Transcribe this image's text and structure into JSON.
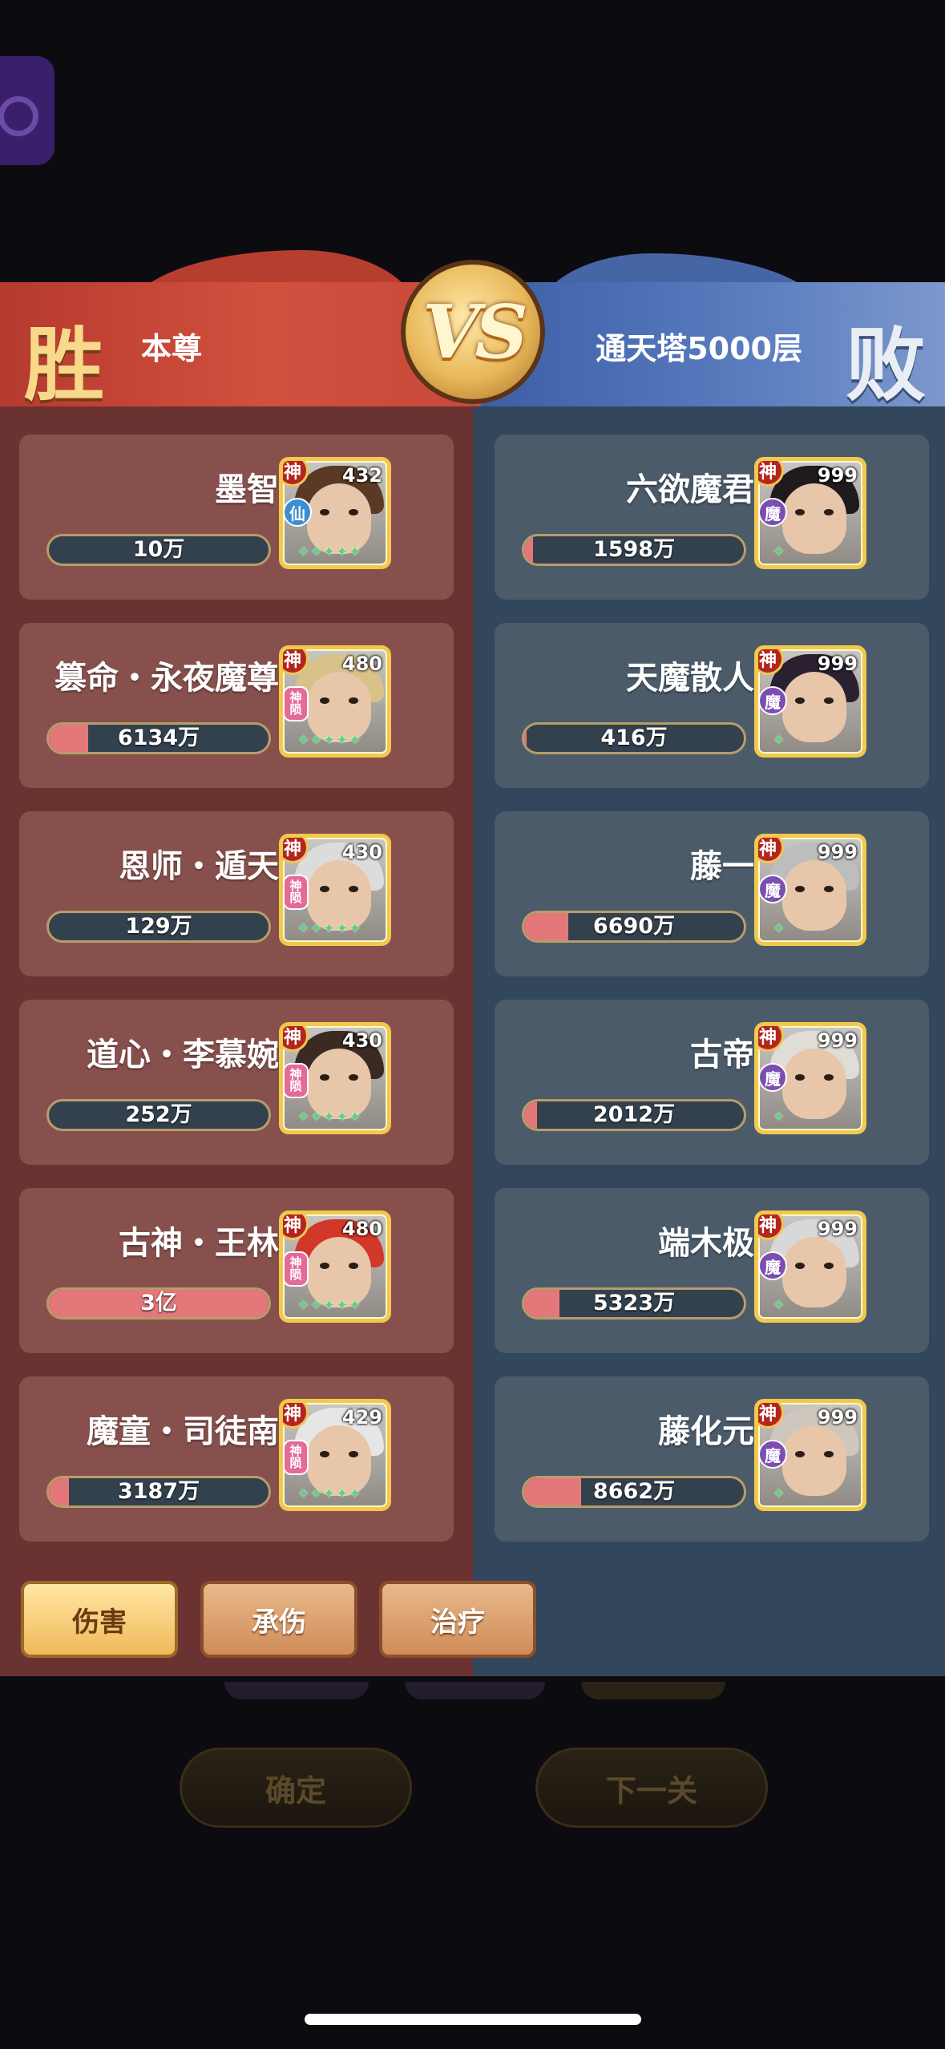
{
  "header": {
    "win_label": "胜",
    "lose_label": "败",
    "vs_label": "VS",
    "left_player": "本尊",
    "right_player": "通天塔5000层"
  },
  "left_team": [
    {
      "name": "墨智",
      "level": "432",
      "rank": "神",
      "faction": "仙",
      "faction_type": "xian",
      "value": "10万",
      "fill": 0.0,
      "hair": "#5a3a24"
    },
    {
      "name": "篡命・永夜魔尊",
      "level": "480",
      "rank": "神",
      "faction": "神陨",
      "faction_type": "sj",
      "value": "6134万",
      "fill": 0.18,
      "hair": "#d8c28a"
    },
    {
      "name": "恩师・遁天",
      "level": "430",
      "rank": "神",
      "faction": "神陨",
      "faction_type": "sj",
      "value": "129万",
      "fill": 0.0,
      "hair": "#dcdcdc"
    },
    {
      "name": "道心・李慕婉",
      "level": "430",
      "rank": "神",
      "faction": "神陨",
      "faction_type": "sj",
      "value": "252万",
      "fill": 0.0,
      "hair": "#3a2a22"
    },
    {
      "name": "古神・王林",
      "level": "480",
      "rank": "神",
      "faction": "神陨",
      "faction_type": "sj",
      "value": "3亿",
      "fill": 1.0,
      "hair": "#d2372a"
    },
    {
      "name": "魔童・司徒南",
      "level": "429",
      "rank": "神",
      "faction": "神陨",
      "faction_type": "sj",
      "value": "3187万",
      "fill": 0.09,
      "hair": "#e6e6e6"
    }
  ],
  "right_team": [
    {
      "name": "六欲魔君",
      "level": "999",
      "rank": "神",
      "faction": "魔",
      "faction_type": "mo",
      "value": "1598万",
      "fill": 0.04,
      "hair": "#1e1a1e"
    },
    {
      "name": "天魔散人",
      "level": "999",
      "rank": "神",
      "faction": "魔",
      "faction_type": "mo",
      "value": "416万",
      "fill": 0.01,
      "hair": "#2a2030"
    },
    {
      "name": "藤一",
      "level": "999",
      "rank": "神",
      "faction": "魔",
      "faction_type": "mo",
      "value": "6690万",
      "fill": 0.2,
      "hair": "#bdbdbd"
    },
    {
      "name": "古帝",
      "level": "999",
      "rank": "神",
      "faction": "魔",
      "faction_type": "mo",
      "value": "2012万",
      "fill": 0.06,
      "hair": "#e0ddd6"
    },
    {
      "name": "端木极",
      "level": "999",
      "rank": "神",
      "faction": "魔",
      "faction_type": "mo",
      "value": "5323万",
      "fill": 0.16,
      "hair": "#d8d8d8"
    },
    {
      "name": "藤化元",
      "level": "999",
      "rank": "神",
      "faction": "魔",
      "faction_type": "mo",
      "value": "8662万",
      "fill": 0.26,
      "hair": "#cfc7bd"
    }
  ],
  "tabs": {
    "damage": "伤害",
    "taken": "承伤",
    "heal": "治疗"
  },
  "background_buttons": {
    "confirm": "确定",
    "next": "下一关"
  },
  "colors": {
    "win_band": "#c84a3b",
    "lose_band": "#5b7ec0",
    "bar_fill": "#e4777a",
    "portrait_border": "#f1c94c"
  }
}
